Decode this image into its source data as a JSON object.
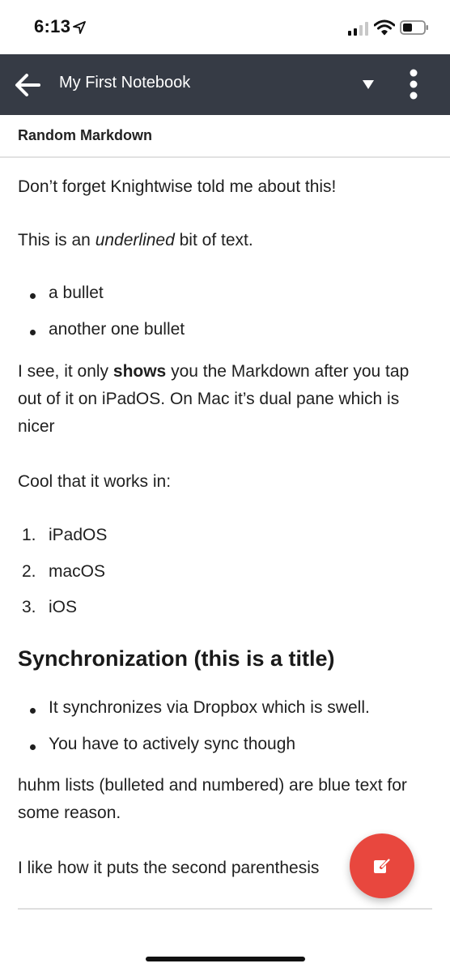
{
  "status_bar": {
    "time": "6:13"
  },
  "app_bar": {
    "notebook_title": "My First Notebook"
  },
  "note": {
    "title": "Random Markdown",
    "p1": "Don’t forget Knightwise told me about this!",
    "p2_before": "This is an ",
    "p2_italic": "underlined",
    "p2_after": " bit of text.",
    "bullets_1": [
      "a bullet",
      "another one bullet"
    ],
    "p3_before": "I see, it only ",
    "p3_bold": "shows",
    "p3_after": " you the Markdown after you tap out of it on iPadOS. On Mac it’s dual pane which is nicer",
    "p4": "Cool that it works in:",
    "numbered": [
      {
        "num": "1.",
        "text": "iPadOS"
      },
      {
        "num": "2.",
        "text": "macOS"
      },
      {
        "num": "3.",
        "text": "iOS"
      }
    ],
    "heading": "Synchronization (this is a title)",
    "bullets_2": [
      "It synchronizes via Dropbox which is swell.",
      "You have to actively sync though"
    ],
    "p5": "huhm lists (bulleted and numbered) are blue text for some reason.",
    "p6": "I like how it puts the second parenthesis"
  },
  "colors": {
    "app_bar_bg": "#363b45",
    "fab_bg": "#e8473e"
  },
  "icons": {
    "back": "arrow-left-icon",
    "dropdown": "triangle-down-icon",
    "more": "more-vertical-icon",
    "fab": "edit-icon"
  }
}
